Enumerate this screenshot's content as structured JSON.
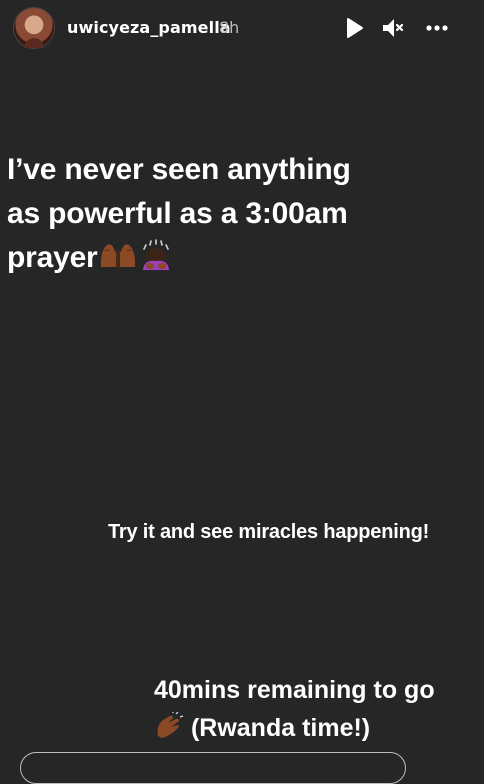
{
  "header": {
    "username": "uwicyeza_pamella",
    "time": "8h",
    "icons": [
      "play-icon",
      "mute-icon",
      "more-options-icon"
    ]
  },
  "story": {
    "headline_line1": "I’ve never seen anything",
    "headline_line2": "as powerful as a 3:00am",
    "headline_line3": "prayer",
    "headline_emojis": [
      "folded-hands-emoji",
      "person-bowing-emoji"
    ],
    "subtext": "Try it and see miracles happening!",
    "remaining_line1": "40mins remaining to go",
    "remaining_line2": "(Rwanda time!)",
    "remaining_emoji": "clapping-hands-emoji"
  },
  "colors": {
    "background": "#262626",
    "text": "#ffffff",
    "muted": "#bdbdbd",
    "emoji_skin": "#8b4a24"
  }
}
